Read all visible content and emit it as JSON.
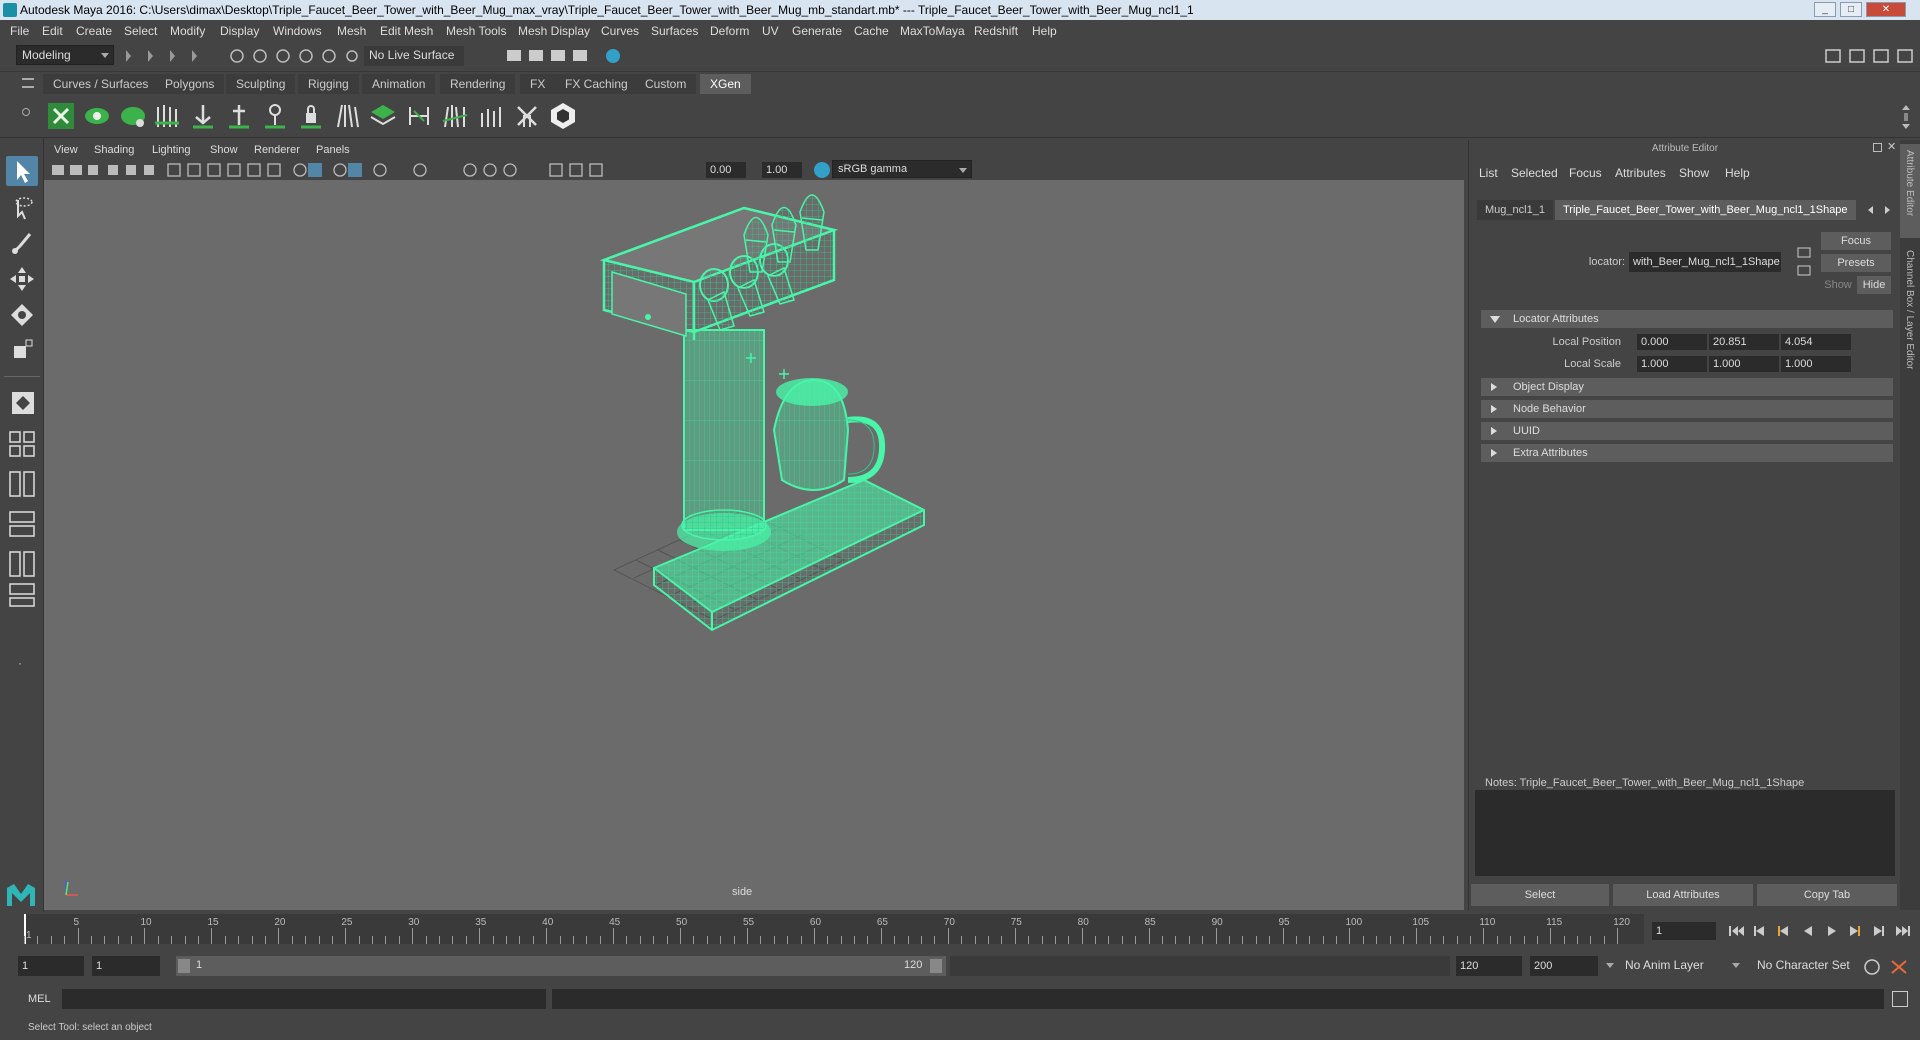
{
  "window": {
    "title": "Autodesk Maya 2016: C:\\Users\\dimax\\Desktop\\Triple_Faucet_Beer_Tower_with_Beer_Mug_max_vray\\Triple_Faucet_Beer_Tower_with_Beer_Mug_mb_standart.mb*   ---   Triple_Faucet_Beer_Tower_with_Beer_Mug_ncl1_1"
  },
  "menubar": [
    "File",
    "Edit",
    "Create",
    "Select",
    "Modify",
    "Display",
    "Windows",
    "Mesh",
    "Edit Mesh",
    "Mesh Tools",
    "Mesh Display",
    "Curves",
    "Surfaces",
    "Deform",
    "UV",
    "Generate",
    "Cache",
    "MaxToMaya",
    "Redshift",
    "Help"
  ],
  "statusline": {
    "mode": "Modeling",
    "live_surface": "No Live Surface"
  },
  "shelf_tabs": [
    "Curves / Surfaces",
    "Polygons",
    "Sculpting",
    "Rigging",
    "Animation",
    "Rendering",
    "FX",
    "FX Caching",
    "Custom",
    "XGen"
  ],
  "shelf_active": "XGen",
  "viewport": {
    "menus": [
      "View",
      "Shading",
      "Lighting",
      "Show",
      "Renderer",
      "Panels"
    ],
    "exposure": "0.00",
    "gamma": "1.00",
    "color_space": "sRGB gamma",
    "camera_label": "side"
  },
  "attribute_editor": {
    "title": "Attribute Editor",
    "menus": [
      "List",
      "Selected",
      "Focus",
      "Attributes",
      "Show",
      "Help"
    ],
    "tabs": [
      "Mug_ncl1_1",
      "Triple_Faucet_Beer_Tower_with_Beer_Mug_ncl1_1Shape"
    ],
    "locator_label": "locator:",
    "locator_value": "with_Beer_Mug_ncl1_1Shape",
    "buttons": {
      "focus": "Focus",
      "presets": "Presets",
      "show": "Show",
      "hide": "Hide"
    },
    "sections": [
      "Locator Attributes",
      "Object Display",
      "Node Behavior",
      "UUID",
      "Extra Attributes"
    ],
    "local_position_label": "Local Position",
    "local_position": [
      "0.000",
      "20.851",
      "4.054"
    ],
    "local_scale_label": "Local Scale",
    "local_scale": [
      "1.000",
      "1.000",
      "1.000"
    ],
    "notes": "Notes:  Triple_Faucet_Beer_Tower_with_Beer_Mug_ncl1_1Shape",
    "bottom_buttons": [
      "Select",
      "Load Attributes",
      "Copy Tab"
    ]
  },
  "side_tabs": [
    "Attribute Editor",
    "Channel Box / Layer Editor"
  ],
  "timeslider": {
    "ticks": [
      "5",
      "10",
      "15",
      "20",
      "25",
      "30",
      "35",
      "40",
      "45",
      "50",
      "55",
      "60",
      "65",
      "70",
      "75",
      "80",
      "85",
      "90",
      "95",
      "100",
      "105",
      "110",
      "115",
      "120"
    ],
    "start_label": "1",
    "current_frame": "1"
  },
  "range": {
    "start": "1",
    "anim_start": "1",
    "range_start": "1",
    "range_end": "120",
    "end": "120",
    "anim_end": "200",
    "anim_layer": "No Anim Layer",
    "character_set": "No Character Set"
  },
  "cmdline": {
    "label": "MEL"
  },
  "helpline": {
    "text": "Select Tool: select an object"
  },
  "colors": {
    "wire": "#49f5a9",
    "selected_tool": "#5285a6",
    "viewport_bg": "#6b6b6b"
  }
}
